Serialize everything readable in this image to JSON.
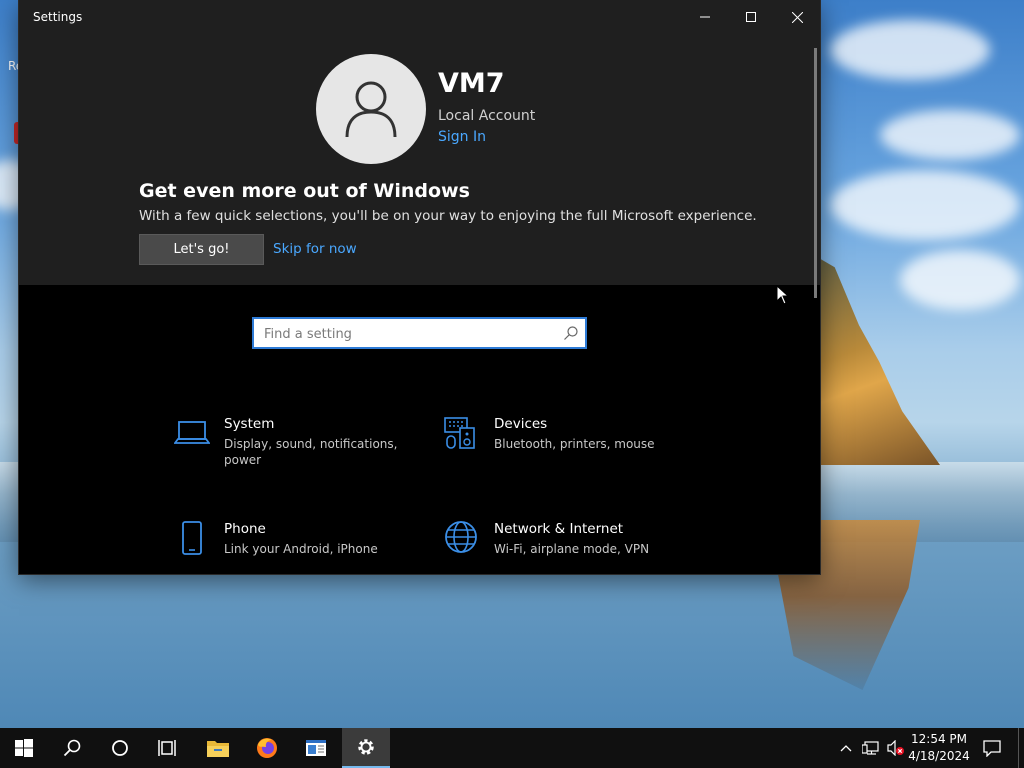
{
  "desktop": {
    "icon_label": "Re"
  },
  "window": {
    "title": "Settings",
    "account": {
      "name": "VM7",
      "type": "Local Account",
      "sign_in": "Sign In"
    },
    "promo": {
      "heading": "Get even more out of Windows",
      "text": "With a few quick selections, you'll be on your way to enjoying the full Microsoft experience.",
      "primary_button": "Let's go!",
      "secondary_link": "Skip for now"
    },
    "search": {
      "placeholder": "Find a setting"
    },
    "categories": [
      {
        "title": "System",
        "description": "Display, sound, notifications, power",
        "icon": "laptop-icon"
      },
      {
        "title": "Devices",
        "description": "Bluetooth, printers, mouse",
        "icon": "devices-icon"
      },
      {
        "title": "Phone",
        "description": "Link your Android, iPhone",
        "icon": "phone-icon"
      },
      {
        "title": "Network & Internet",
        "description": "Wi-Fi, airplane mode, VPN",
        "icon": "globe-icon"
      }
    ]
  },
  "taskbar": {
    "pinned": [
      "start-icon",
      "search-icon",
      "cortana-icon",
      "task-view-icon",
      "file-explorer-icon",
      "firefox-icon",
      "app-icon",
      "settings-icon"
    ],
    "clock": {
      "time": "12:54 PM",
      "date": "4/18/2024"
    }
  },
  "colors": {
    "accent": "#4aa8ff",
    "search_border": "#2e7bd6",
    "icon_blue": "#3b8ee6",
    "window_bg": "#000000",
    "banner_bg": "#1f1f1f",
    "taskbar_bg": "#101010"
  }
}
